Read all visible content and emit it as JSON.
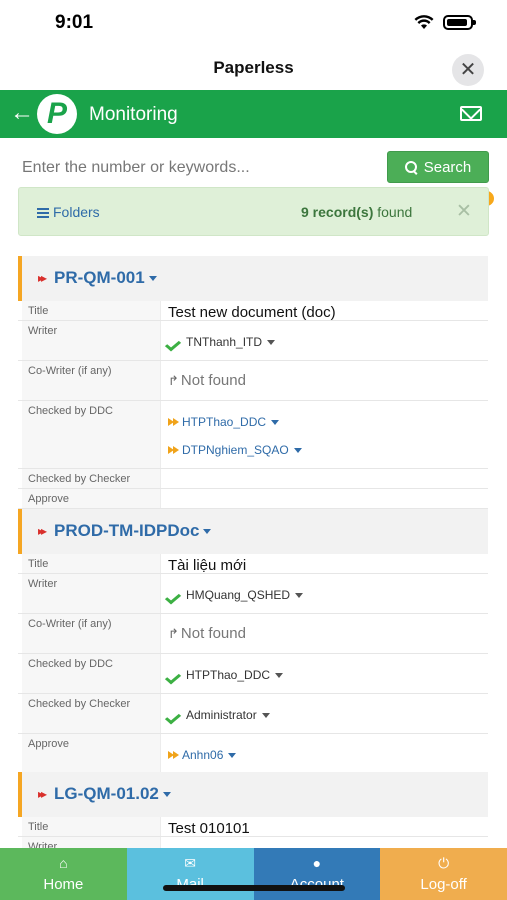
{
  "status_bar": {
    "time": "9:01"
  },
  "app": {
    "title": "Paperless",
    "close_icon": "close-icon"
  },
  "header": {
    "title": "Monitoring",
    "back_icon": "back-arrow-icon",
    "logo_letter": "P",
    "mail_badge": "0",
    "accent_color": "#1aa34a"
  },
  "search": {
    "placeholder": "Enter the number or keywords...",
    "button_label": "Search"
  },
  "folders_bar": {
    "folders_label": "Folders",
    "record_count": "9 record(s)",
    "found_suffix": " found"
  },
  "labels": {
    "title": "Title",
    "writer": "Writer",
    "co_writer": "Co-Writer (if any)",
    "checked_ddc": "Checked by DDC",
    "checked_checker": "Checked by Checker",
    "approve": "Approve"
  },
  "records": [
    {
      "code": "PR-QM-001",
      "title": "Test new document (doc)",
      "writer": "TNThanh_ITD",
      "co_writer": "Not found",
      "checked_ddc": [
        "HTPThao_DDC",
        "DTPNghiem_SQAO"
      ],
      "checked_checker": "",
      "approve": ""
    },
    {
      "code": "PROD-TM-IDPDoc",
      "title": "Tài liệu mới",
      "writer": "HMQuang_QSHED",
      "co_writer": "Not found",
      "checked_ddc": [
        "HTPThao_DDC"
      ],
      "checked_checker": "Administrator",
      "approve": "Anhn06"
    },
    {
      "code": "LG-QM-01.02",
      "title": "Test 010101",
      "writer": ""
    }
  ],
  "tabs": [
    {
      "label": "Home",
      "icon": "home-icon"
    },
    {
      "label": "Mail",
      "icon": "mail-icon"
    },
    {
      "label": "Account",
      "icon": "user-icon"
    },
    {
      "label": "Log-off",
      "icon": "power-icon"
    }
  ]
}
